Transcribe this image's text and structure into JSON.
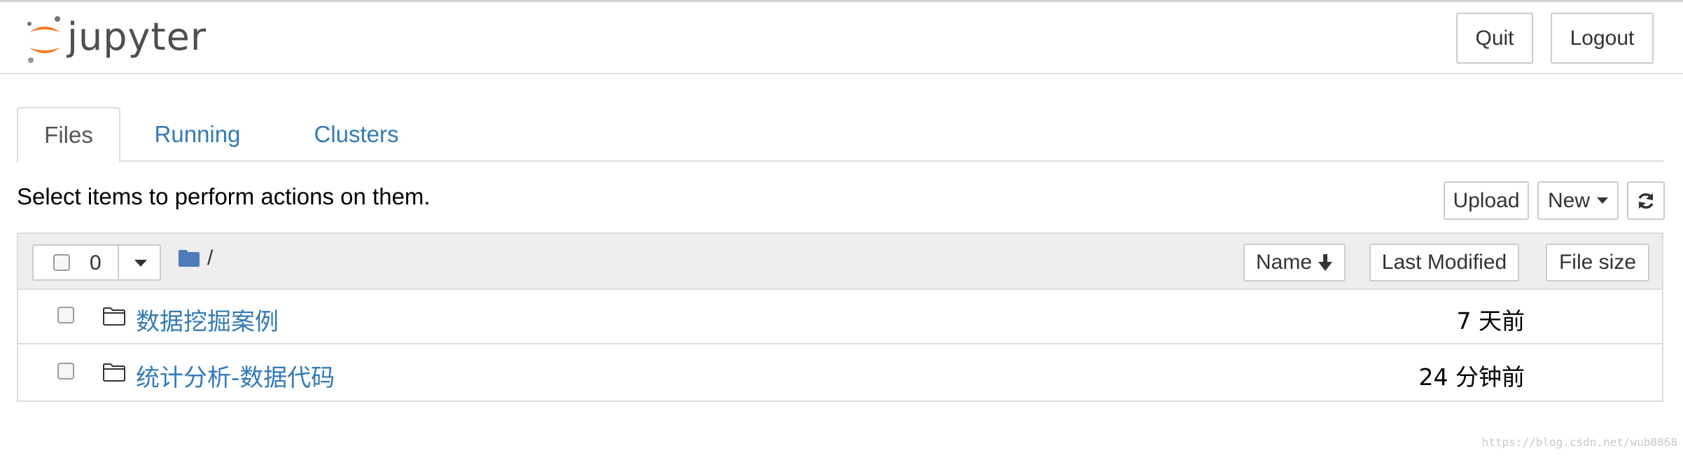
{
  "header": {
    "logo_text": "jupyter",
    "quit_label": "Quit",
    "logout_label": "Logout"
  },
  "tabs": [
    {
      "label": "Files",
      "active": true
    },
    {
      "label": "Running",
      "active": false
    },
    {
      "label": "Clusters",
      "active": false
    }
  ],
  "toolbar": {
    "instruction": "Select items to perform actions on them.",
    "upload_label": "Upload",
    "new_label": "New",
    "refresh_icon": "refresh-icon"
  },
  "list_header": {
    "selected_count": "0",
    "breadcrumb_separator": "/",
    "sort_name_label": "Name",
    "sort_modified_label": "Last Modified",
    "sort_size_label": "File size"
  },
  "items": [
    {
      "name": "数据挖掘案例",
      "modified": "7 天前",
      "type": "folder"
    },
    {
      "name": "统计分析-数据代码",
      "modified": "24 分钟前",
      "type": "folder"
    }
  ],
  "watermark": "https://blog.csdn.net/wub8868",
  "colors": {
    "link": "#337ab7",
    "logo_orange": "#f37726",
    "logo_text": "#4e4e4e",
    "panel_header_bg": "#eeeeee",
    "folder_blue": "#4f7cb8"
  }
}
